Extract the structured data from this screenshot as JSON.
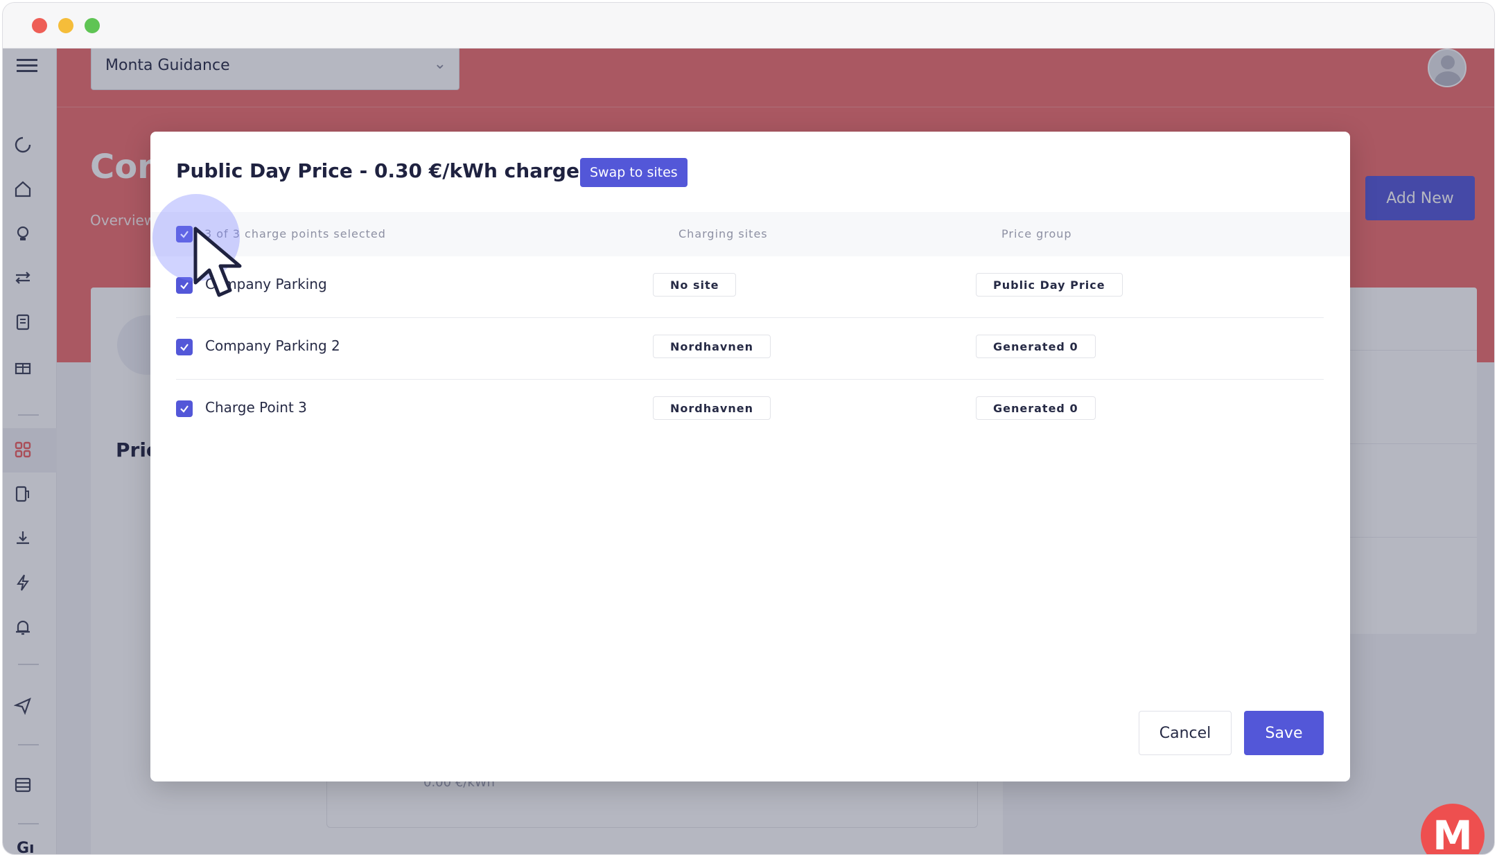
{
  "window": {
    "buttons": [
      "close",
      "minimize",
      "maximize"
    ]
  },
  "header": {
    "org_select": "Monta Guidance",
    "page_title": "Com",
    "breadcrumb": "Overview",
    "add_new_label": "Add New"
  },
  "sidebar": {
    "icons": [
      "menu-icon",
      "refresh-icon",
      "home-icon",
      "lightbulb-icon",
      "transfer-icon",
      "document-icon",
      "gift-icon",
      "grid-icon",
      "charger-icon",
      "download-icon",
      "lightning-icon",
      "alarm-icon",
      "send-icon",
      "layers-icon"
    ],
    "bottom_text": "Gı"
  },
  "background": {
    "price_heading": "Pric",
    "inner_value": "0.00 €/kWh"
  },
  "modal": {
    "title": "Public Day Price - 0.30 €/kWh charge points",
    "swap_label": "Swap to sites",
    "columns": {
      "select_all": "3 of 3 charge points selected",
      "sites": "Charging sites",
      "group": "Price group"
    },
    "rows": [
      {
        "name": "Company Parking",
        "site": "No site",
        "group": "Public Day Price",
        "checked": true
      },
      {
        "name": "Company Parking 2",
        "site": "Nordhavnen",
        "group": "Generated 0",
        "checked": true
      },
      {
        "name": "Charge Point 3",
        "site": "Nordhavnen",
        "group": "Generated 0",
        "checked": true
      }
    ],
    "cancel_label": "Cancel",
    "save_label": "Save"
  },
  "badge": {
    "letter": "M"
  },
  "colors": {
    "accent": "#5357d8",
    "header": "#ee6e6e",
    "badge": "#ee4f4f"
  }
}
